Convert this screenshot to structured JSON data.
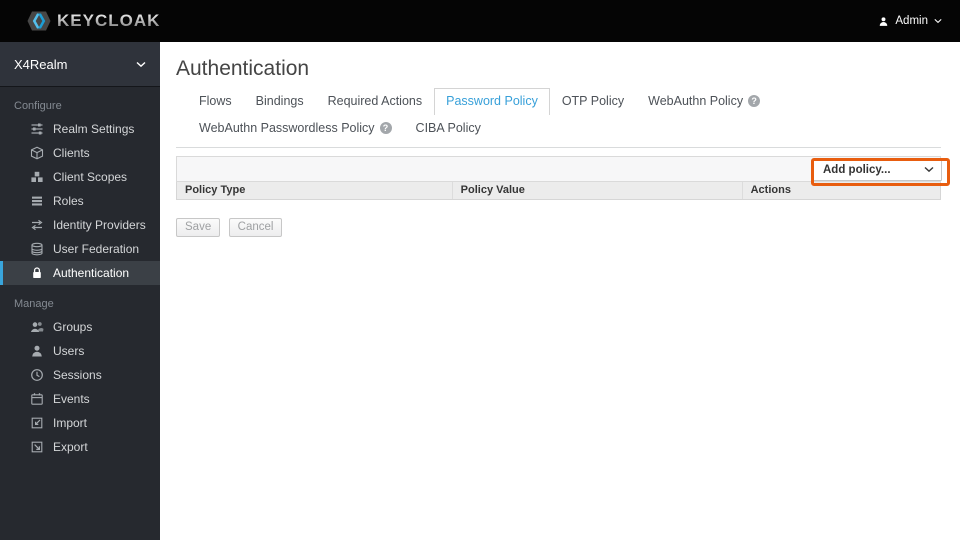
{
  "topbar": {
    "brand": "KEYCLOAK",
    "user_label": "Admin"
  },
  "sidebar": {
    "realm_name": "X4Realm",
    "sections": [
      {
        "label": "Configure",
        "items": [
          {
            "label": "Realm Settings",
            "icon": "sliders-icon"
          },
          {
            "label": "Clients",
            "icon": "cube-icon"
          },
          {
            "label": "Client Scopes",
            "icon": "cubes-icon"
          },
          {
            "label": "Roles",
            "icon": "list-icon"
          },
          {
            "label": "Identity Providers",
            "icon": "exchange-icon"
          },
          {
            "label": "User Federation",
            "icon": "database-icon"
          },
          {
            "label": "Authentication",
            "icon": "lock-icon",
            "selected": true
          }
        ]
      },
      {
        "label": "Manage",
        "items": [
          {
            "label": "Groups",
            "icon": "users-icon"
          },
          {
            "label": "Users",
            "icon": "user-icon"
          },
          {
            "label": "Sessions",
            "icon": "clock-icon"
          },
          {
            "label": "Events",
            "icon": "calendar-icon"
          },
          {
            "label": "Import",
            "icon": "import-icon"
          },
          {
            "label": "Export",
            "icon": "export-icon"
          }
        ]
      }
    ]
  },
  "main": {
    "title": "Authentication",
    "help_glyph": "?",
    "tabs": [
      {
        "label": "Flows"
      },
      {
        "label": "Bindings"
      },
      {
        "label": "Required Actions"
      },
      {
        "label": "Password Policy",
        "active": true
      },
      {
        "label": "OTP Policy"
      },
      {
        "label": "WebAuthn Policy",
        "help": true
      },
      {
        "label": "WebAuthn Passwordless Policy",
        "help": true
      },
      {
        "label": "CIBA Policy"
      }
    ],
    "toolbar": {
      "add_policy_label": "Add policy..."
    },
    "table": {
      "headers": [
        "Policy Type",
        "Policy Value",
        "Actions"
      ],
      "rows": []
    },
    "buttons": {
      "save": "Save",
      "cancel": "Cancel"
    }
  },
  "colors": {
    "accent_blue": "#39a5dc",
    "active_tab_text": "#38a0d9",
    "highlight_orange": "#e85d0f",
    "topbar_bg": "#050505",
    "sidebar_bg": "#26292f"
  }
}
